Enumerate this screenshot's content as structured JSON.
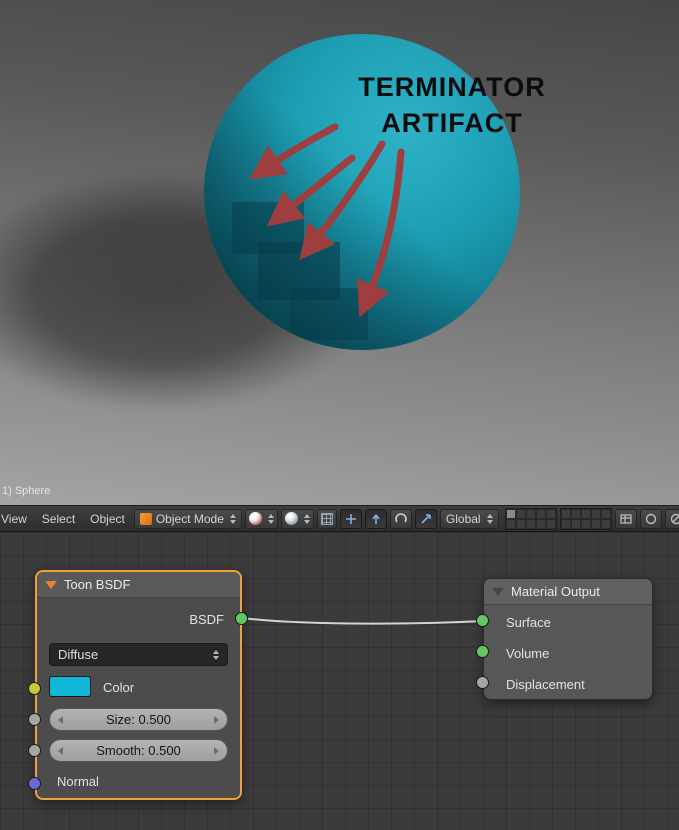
{
  "viewport": {
    "annotation": {
      "line1": "TERMINATOR",
      "line2": "ARTIFACT"
    },
    "info_text": "1) Sphere",
    "sphere_color": "#15879b",
    "arrow_color": "#9e3e3e",
    "arrow_count": 4
  },
  "header": {
    "menus": [
      {
        "label": "View"
      },
      {
        "label": "Select"
      },
      {
        "label": "Object"
      }
    ],
    "mode_dropdown": {
      "value": "Object Mode",
      "icon": "cube-icon"
    },
    "shading_dropdown": {
      "icon": "material-sphere-icon"
    },
    "pivot_dropdown": {
      "icon": "pivot-sphere-icon"
    },
    "orientation_dropdown": {
      "value": "Global"
    },
    "layer_groups": 2,
    "layers_per_group": 10
  },
  "node_editor": {
    "toon_node": {
      "title": "Toon BSDF",
      "output_label": "BSDF",
      "component_dropdown": "Diffuse",
      "color_label": "Color",
      "size_slider": "Size: 0.500",
      "smooth_slider": "Smooth: 0.500",
      "normal_label": "Normal",
      "color_swatch": "#10b7d7",
      "selection_color": "#f0a13a"
    },
    "output_node": {
      "title": "Material Output",
      "inputs": [
        {
          "label": "Surface",
          "socket_color": "#63c763"
        },
        {
          "label": "Volume",
          "socket_color": "#63c763"
        },
        {
          "label": "Displacement",
          "socket_color": "#a6a6a6"
        }
      ]
    },
    "socket_colors": {
      "bsdf_output": "#63c763",
      "color_input": "#c9c936",
      "size_input": "#a6a6a6",
      "smooth_input": "#a6a6a6",
      "normal_input": "#6a6ad4"
    }
  }
}
